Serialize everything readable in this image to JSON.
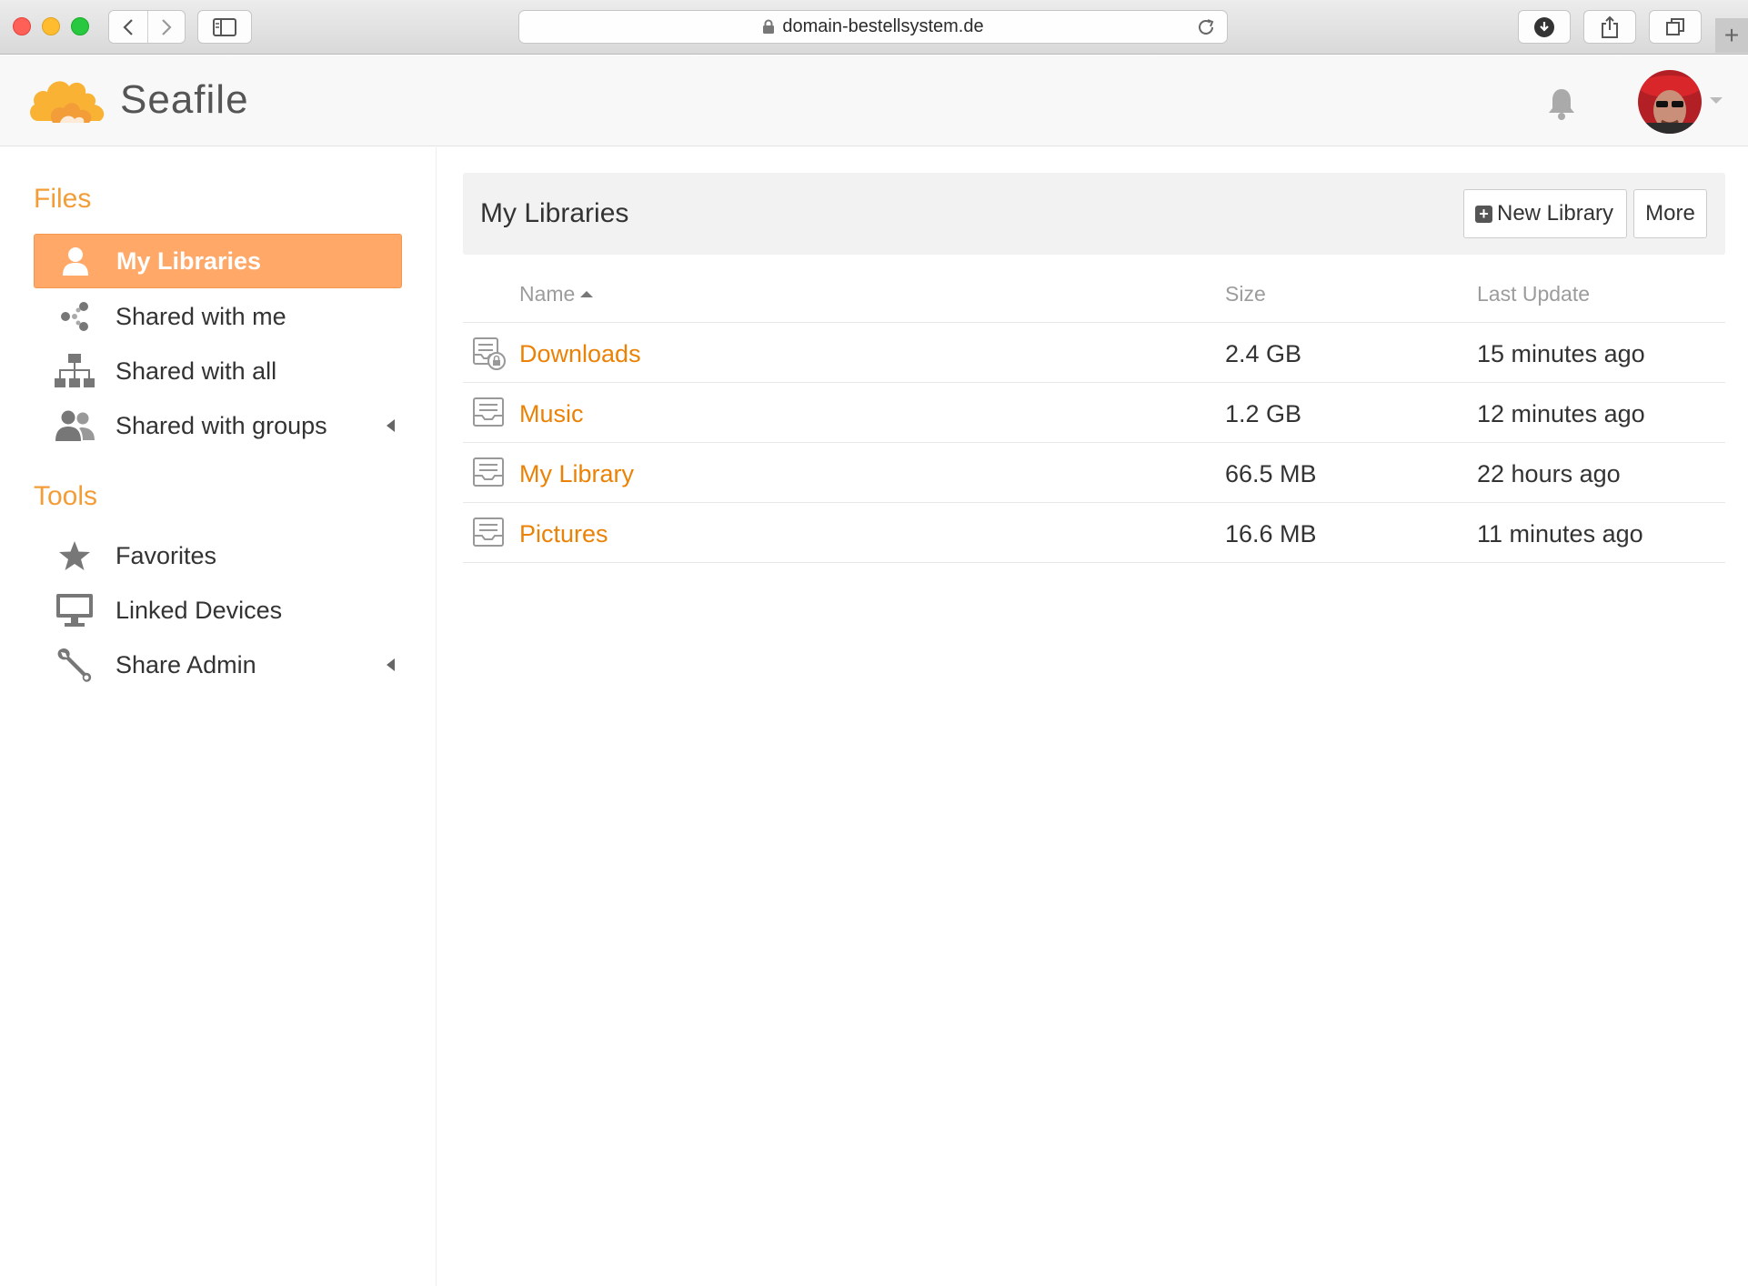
{
  "browser": {
    "url": "domain-bestellsystem.de"
  },
  "app": {
    "name": "Seafile",
    "brand_color": "#f39d38",
    "active_color": "#ffa868",
    "link_color": "#eb8205"
  },
  "sidebar": {
    "files_heading": "Files",
    "tools_heading": "Tools",
    "files_items": [
      {
        "label": "My Libraries",
        "icon": "user-icon",
        "active": true
      },
      {
        "label": "Shared with me",
        "icon": "share-icon"
      },
      {
        "label": "Shared with all",
        "icon": "sitemap-icon"
      },
      {
        "label": "Shared with groups",
        "icon": "group-icon",
        "expandable": true
      }
    ],
    "tools_items": [
      {
        "label": "Favorites",
        "icon": "star-icon"
      },
      {
        "label": "Linked Devices",
        "icon": "monitor-icon"
      },
      {
        "label": "Share Admin",
        "icon": "wrench-icon",
        "expandable": true
      }
    ]
  },
  "main": {
    "title": "My Libraries",
    "new_library_label": "New Library",
    "more_label": "More",
    "columns": {
      "name": "Name",
      "size": "Size",
      "last_update": "Last Update"
    },
    "libraries": [
      {
        "name": "Downloads",
        "size": "2.4 GB",
        "last_update": "15 minutes ago",
        "encrypted": true
      },
      {
        "name": "Music",
        "size": "1.2 GB",
        "last_update": "12 minutes ago"
      },
      {
        "name": "My Library",
        "size": "66.5 MB",
        "last_update": "22 hours ago"
      },
      {
        "name": "Pictures",
        "size": "16.6 MB",
        "last_update": "11 minutes ago"
      }
    ]
  }
}
